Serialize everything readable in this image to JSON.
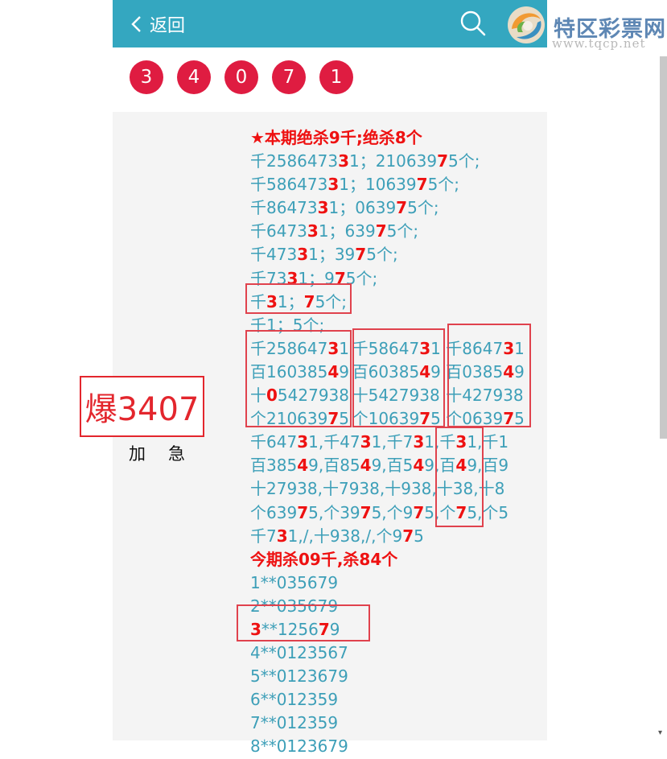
{
  "header": {
    "back_label": "返回"
  },
  "brand": {
    "name": "特区彩票网",
    "url": "www.tqcp.net"
  },
  "balls": [
    "3",
    "4",
    "0",
    "7",
    "1"
  ],
  "badge": {
    "title": "爆3407",
    "subtitle": "加急"
  },
  "post": {
    "title": "★本期绝杀9千;绝杀8个",
    "funnel": [
      [
        {
          "t": "千2586473"
        },
        {
          "t": "3",
          "r": true
        },
        {
          "t": "1；210639"
        },
        {
          "t": "7",
          "r": true
        },
        {
          "t": "5个;"
        }
      ],
      [
        {
          "t": "千586473"
        },
        {
          "t": "3",
          "r": true
        },
        {
          "t": "1；10639"
        },
        {
          "t": "7",
          "r": true
        },
        {
          "t": "5个;"
        }
      ],
      [
        {
          "t": "千86473"
        },
        {
          "t": "3",
          "r": true
        },
        {
          "t": "1；0639"
        },
        {
          "t": "7",
          "r": true
        },
        {
          "t": "5个;"
        }
      ],
      [
        {
          "t": "千6473"
        },
        {
          "t": "3",
          "r": true
        },
        {
          "t": "1；639"
        },
        {
          "t": "7",
          "r": true
        },
        {
          "t": "5个;"
        }
      ],
      [
        {
          "t": "千473"
        },
        {
          "t": "3",
          "r": true
        },
        {
          "t": "1；39"
        },
        {
          "t": "7",
          "r": true
        },
        {
          "t": "5个;"
        }
      ],
      [
        {
          "t": "千73"
        },
        {
          "t": "3",
          "r": true
        },
        {
          "t": "1；9"
        },
        {
          "t": "7",
          "r": true
        },
        {
          "t": "5个;"
        }
      ],
      [
        {
          "t": "千"
        },
        {
          "t": "3",
          "r": true
        },
        {
          "t": "1；"
        },
        {
          "t": "7",
          "r": true
        },
        {
          "t": "5个;"
        }
      ],
      [
        {
          "t": "千1；5个;"
        }
      ]
    ],
    "grid": [
      [
        [
          {
            "t": "千258647"
          },
          {
            "t": "3",
            "r": true
          },
          {
            "t": "1"
          }
        ],
        [
          {
            "t": "千58647"
          },
          {
            "t": "3",
            "r": true
          },
          {
            "t": "1"
          }
        ],
        [
          {
            "t": "千8647"
          },
          {
            "t": "3",
            "r": true
          },
          {
            "t": "1"
          }
        ]
      ],
      [
        [
          {
            "t": "百160385"
          },
          {
            "t": "4",
            "r": true
          },
          {
            "t": "9"
          }
        ],
        [
          {
            "t": "百60385"
          },
          {
            "t": "4",
            "r": true
          },
          {
            "t": "9"
          }
        ],
        [
          {
            "t": "百0385"
          },
          {
            "t": "4",
            "r": true
          },
          {
            "t": "9"
          }
        ]
      ],
      [
        [
          {
            "t": "十"
          },
          {
            "t": "0",
            "r": true
          },
          {
            "t": "5427938"
          }
        ],
        [
          {
            "t": "十5427938"
          }
        ],
        [
          {
            "t": "十427938"
          }
        ]
      ],
      [
        [
          {
            "t": "个210639"
          },
          {
            "t": "7",
            "r": true
          },
          {
            "t": "5"
          }
        ],
        [
          {
            "t": "个10639"
          },
          {
            "t": "7",
            "r": true
          },
          {
            "t": "5"
          }
        ],
        [
          {
            "t": "个0639"
          },
          {
            "t": "7",
            "r": true
          },
          {
            "t": "5"
          }
        ]
      ]
    ],
    "chain": [
      [
        {
          "t": "千647"
        },
        {
          "t": "3",
          "r": true
        },
        {
          "t": "1,千47"
        },
        {
          "t": "3",
          "r": true
        },
        {
          "t": "1,千7"
        },
        {
          "t": "3",
          "r": true
        },
        {
          "t": "1,千"
        },
        {
          "t": "3",
          "r": true
        },
        {
          "t": "1,千1"
        }
      ],
      [
        {
          "t": "百385"
        },
        {
          "t": "4",
          "r": true
        },
        {
          "t": "9,百85"
        },
        {
          "t": "4",
          "r": true
        },
        {
          "t": "9,百5"
        },
        {
          "t": "4",
          "r": true
        },
        {
          "t": "9,百"
        },
        {
          "t": "4",
          "r": true
        },
        {
          "t": "9,百9"
        }
      ],
      [
        {
          "t": "十27938,十7938,十938,十38,十8"
        }
      ],
      [
        {
          "t": "个639"
        },
        {
          "t": "7",
          "r": true
        },
        {
          "t": "5,个39"
        },
        {
          "t": "7",
          "r": true
        },
        {
          "t": "5,个9"
        },
        {
          "t": "7",
          "r": true
        },
        {
          "t": "5,个"
        },
        {
          "t": "7",
          "r": true
        },
        {
          "t": "5,个5"
        }
      ],
      [
        {
          "t": "千7"
        },
        {
          "t": "3",
          "r": true
        },
        {
          "t": "1,/,十938,/,个9"
        },
        {
          "t": "7",
          "r": true
        },
        {
          "t": "5"
        }
      ]
    ],
    "subtitle": "今期杀09千,杀84个",
    "combos": [
      [
        {
          "t": "1**035679"
        }
      ],
      [
        {
          "t": "2**035679"
        }
      ],
      [
        {
          "t": "3",
          "r": true
        },
        {
          "t": "**12567"
        },
        {
          "t": "9",
          "r": false
        },
        {
          "t": ""
        }
      ],
      [
        {
          "t": "4**0123567"
        }
      ],
      [
        {
          "t": "5**0123679"
        }
      ],
      [
        {
          "t": "6**012359"
        }
      ],
      [
        {
          "t": "7**012359"
        }
      ],
      [
        {
          "t": "8**0123679"
        }
      ]
    ]
  },
  "colors": {
    "header": "#34a7c0",
    "ball": "#df1c41",
    "text": "#3d9fb8",
    "highlight": "#ee1111"
  }
}
